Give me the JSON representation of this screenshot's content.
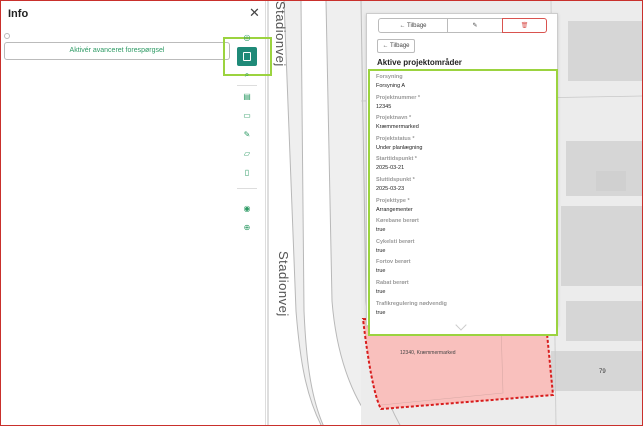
{
  "panel": {
    "title": "Info",
    "close_label": "✕",
    "advanced_query_label": "Aktivér avanceret forespørgsel"
  },
  "toolbar": {
    "tools": [
      {
        "name": "layers-eye-icon",
        "glyph": "◎"
      },
      {
        "name": "info-icon",
        "active": true
      },
      {
        "name": "search-zoom-icon",
        "glyph": "⌕"
      },
      {
        "name": "map-icon",
        "glyph": "▤"
      },
      {
        "name": "print-icon",
        "glyph": "▭"
      },
      {
        "name": "pencil-icon",
        "glyph": "✎"
      },
      {
        "name": "folder-icon",
        "glyph": "▱"
      },
      {
        "name": "document-icon",
        "glyph": "▯"
      },
      {
        "name": "camera-icon",
        "glyph": "◉"
      },
      {
        "name": "globe-icon",
        "glyph": "⊕"
      }
    ]
  },
  "map": {
    "street_name_top": "Stadionvej",
    "street_name_side": "Stadionvej",
    "area_label": "12340, Kræmmermarked",
    "house_number": "79"
  },
  "popup": {
    "back_tab_label": "← Tilbage",
    "edit_tab_icon": "✎",
    "delete_tab_icon": "🗑",
    "back_button_label": "← Tilbage",
    "title": "Aktive projektområder",
    "fields": [
      {
        "label": "Forsyning",
        "value": "Forsyning A"
      },
      {
        "label": "Projektnummer *",
        "value": "12345"
      },
      {
        "label": "Projektnavn *",
        "value": "Kræmmermarked"
      },
      {
        "label": "Projektstatus *",
        "value": "Under planlægning"
      },
      {
        "label": "Starttidspunkt *",
        "value": "2025-03-21"
      },
      {
        "label": "Sluttidspunkt *",
        "value": "2025-03-23"
      },
      {
        "label": "Projekttype *",
        "value": "Arrangementer"
      },
      {
        "label": "Kørebane berørt",
        "value": "true"
      },
      {
        "label": "Cykelsti berørt",
        "value": "true"
      },
      {
        "label": "Fortov berørt",
        "value": "true"
      },
      {
        "label": "Rabat berørt",
        "value": "true"
      },
      {
        "label": "Trafikregulering nødvendig",
        "value": "true"
      }
    ]
  },
  "colors": {
    "accent_green": "#2d9a64",
    "highlight_lime": "#9bd33f",
    "active_tool_bg": "#1f8a78",
    "area_fill": "#f9c0bd",
    "area_border": "#d81c1c",
    "delete_red": "#d9534f"
  }
}
